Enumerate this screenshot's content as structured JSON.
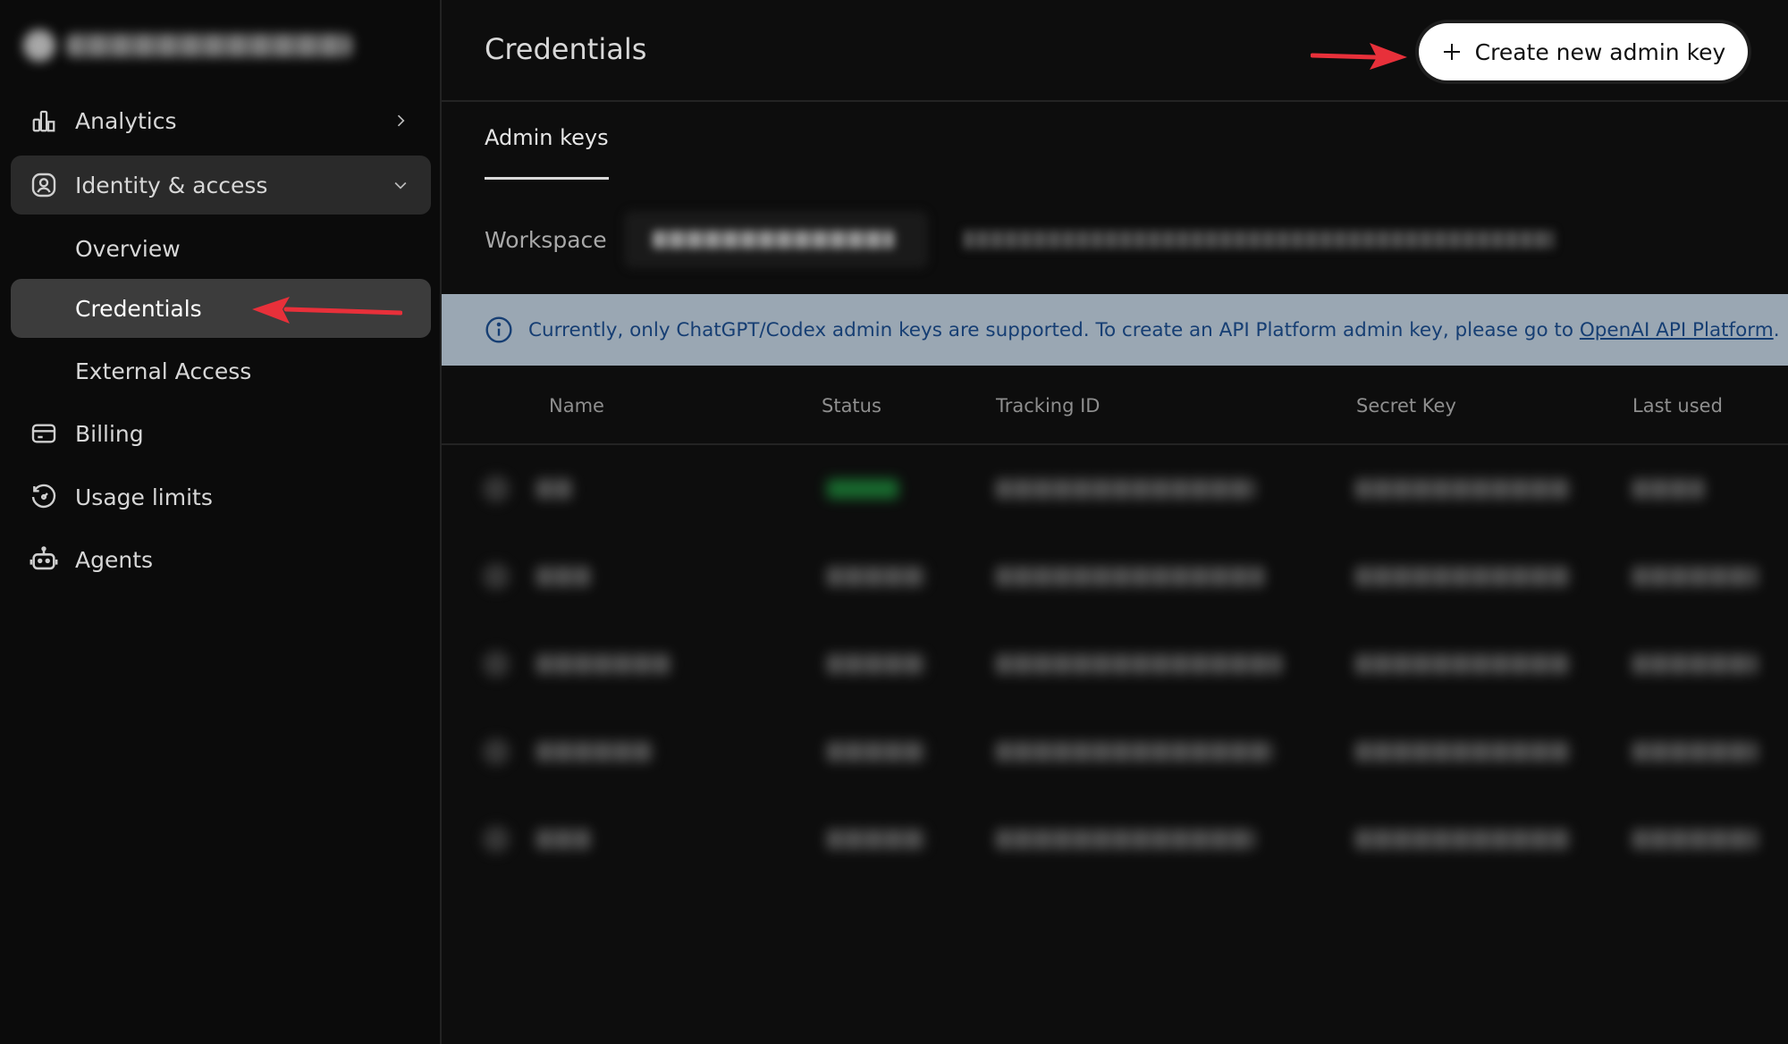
{
  "sidebar": {
    "items": [
      {
        "label": "Analytics",
        "icon": "bar-chart-icon"
      },
      {
        "label": "Identity & access",
        "icon": "user-shield-icon"
      },
      {
        "label": "Overview"
      },
      {
        "label": "Credentials"
      },
      {
        "label": "External Access"
      },
      {
        "label": "Billing",
        "icon": "credit-card-icon"
      },
      {
        "label": "Usage limits",
        "icon": "gauge-icon"
      },
      {
        "label": "Agents",
        "icon": "robot-icon"
      }
    ],
    "active": "Credentials"
  },
  "header": {
    "title": "Credentials",
    "create_button": "Create new admin key"
  },
  "tabs": [
    "Admin keys"
  ],
  "workspace": {
    "label": "Workspace"
  },
  "banner": {
    "message": "Currently, only ChatGPT/Codex admin keys are supported. To create an API Platform admin key, please go to ",
    "link": "OpenAI API Platform",
    "end": ".",
    "bg_color": "#9aa7b3",
    "text_color": "#163e73"
  },
  "table": {
    "columns": [
      "Name",
      "Status",
      "Tracking ID",
      "Secret Key",
      "Last used"
    ]
  }
}
